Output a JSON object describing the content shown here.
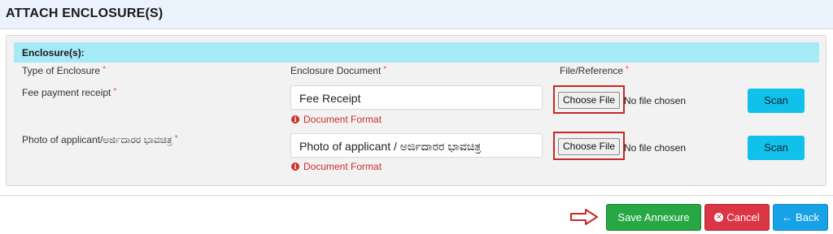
{
  "header": {
    "title": "ATTACH ENCLOSURE(S)"
  },
  "panel": {
    "title": "Enclosure(s):",
    "columns": {
      "type": "Type of Enclosure",
      "document": "Enclosure Document",
      "file": "File/Reference",
      "required_mark": "*"
    },
    "rows": [
      {
        "label": "Fee payment receipt",
        "document_value": "Fee Receipt",
        "format_link": "Document Format",
        "choose_file_label": "Choose File",
        "file_status": "No file chosen",
        "scan_label": "Scan"
      },
      {
        "label": "Photo of applicant/ಅರ್ಜಿದಾರರ ಭಾವಚಿತ್ರ",
        "document_value": "Photo of applicant / ಅರ್ಜಿದಾರರ ಭಾವಚಿತ್ರ",
        "format_link": "Document Format",
        "choose_file_label": "Choose File",
        "file_status": "No file chosen",
        "scan_label": "Scan"
      }
    ]
  },
  "footer": {
    "save_label": "Save Annexure",
    "cancel_label": "Cancel",
    "back_label": "Back"
  },
  "colors": {
    "header_bg": "#eaf2fb",
    "panel_header_bg": "#a6e9f7",
    "scan_button": "#10c1ea",
    "save_button": "#28a745",
    "cancel_button": "#dc3545",
    "back_button": "#17a2e8",
    "highlight_border": "#c62828",
    "error_text": "#c9302c"
  },
  "icons": {
    "info": "info-circle-icon",
    "cancel": "times-circle-icon",
    "back": "arrow-left-icon",
    "pointer": "right-arrow-outline-icon"
  }
}
